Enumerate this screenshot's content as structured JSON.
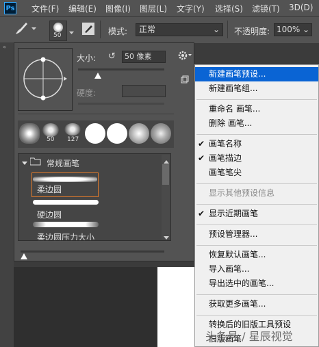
{
  "menubar": {
    "logo": "Ps",
    "items": [
      "文件(F)",
      "编辑(E)",
      "图像(I)",
      "图层(L)",
      "文字(Y)",
      "选择(S)",
      "滤镜(T)",
      "3D(D)"
    ]
  },
  "options_bar": {
    "brush_size": "50",
    "mode_label": "模式:",
    "mode_value": "正常",
    "opacity_label": "不透明度:",
    "opacity_value": "100%"
  },
  "panel": {
    "size_label": "大小:",
    "size_value": "50 像素",
    "hardness_label": "硬度:",
    "tip_numbers": [
      "50",
      "127"
    ],
    "group_name": "常规画笔",
    "brushes": [
      "柔边圆",
      "硬边圆",
      "柔边圆压力大小"
    ]
  },
  "menu": {
    "items": [
      {
        "label": "新建画笔预设...",
        "state": "highlighted"
      },
      {
        "label": "新建画笔组...",
        "state": ""
      },
      {
        "label": "重命名 画笔...",
        "state": ""
      },
      {
        "label": "删除 画笔...",
        "state": ""
      },
      {
        "label": "画笔名称",
        "state": "checked"
      },
      {
        "label": "画笔描边",
        "state": "checked"
      },
      {
        "label": "画笔笔尖",
        "state": ""
      },
      {
        "label": "显示其他预设信息",
        "state": "disabled"
      },
      {
        "label": "显示近期画笔",
        "state": "checked"
      },
      {
        "label": "预设管理器...",
        "state": ""
      },
      {
        "label": "恢复默认画笔...",
        "state": ""
      },
      {
        "label": "导入画笔...",
        "state": ""
      },
      {
        "label": "导出选中的画笔...",
        "state": ""
      },
      {
        "label": "获取更多画笔...",
        "state": ""
      },
      {
        "label": "转换后的旧版工具预设",
        "state": ""
      },
      {
        "label": "旧版画笔",
        "state": ""
      }
    ],
    "check_mark": "✔"
  },
  "watermark": "头条号 / 星辰视觉",
  "colors": {
    "highlight": "#0a64d4",
    "selection_outline": "#e07a2c",
    "ps_blue": "#31a8ff"
  }
}
